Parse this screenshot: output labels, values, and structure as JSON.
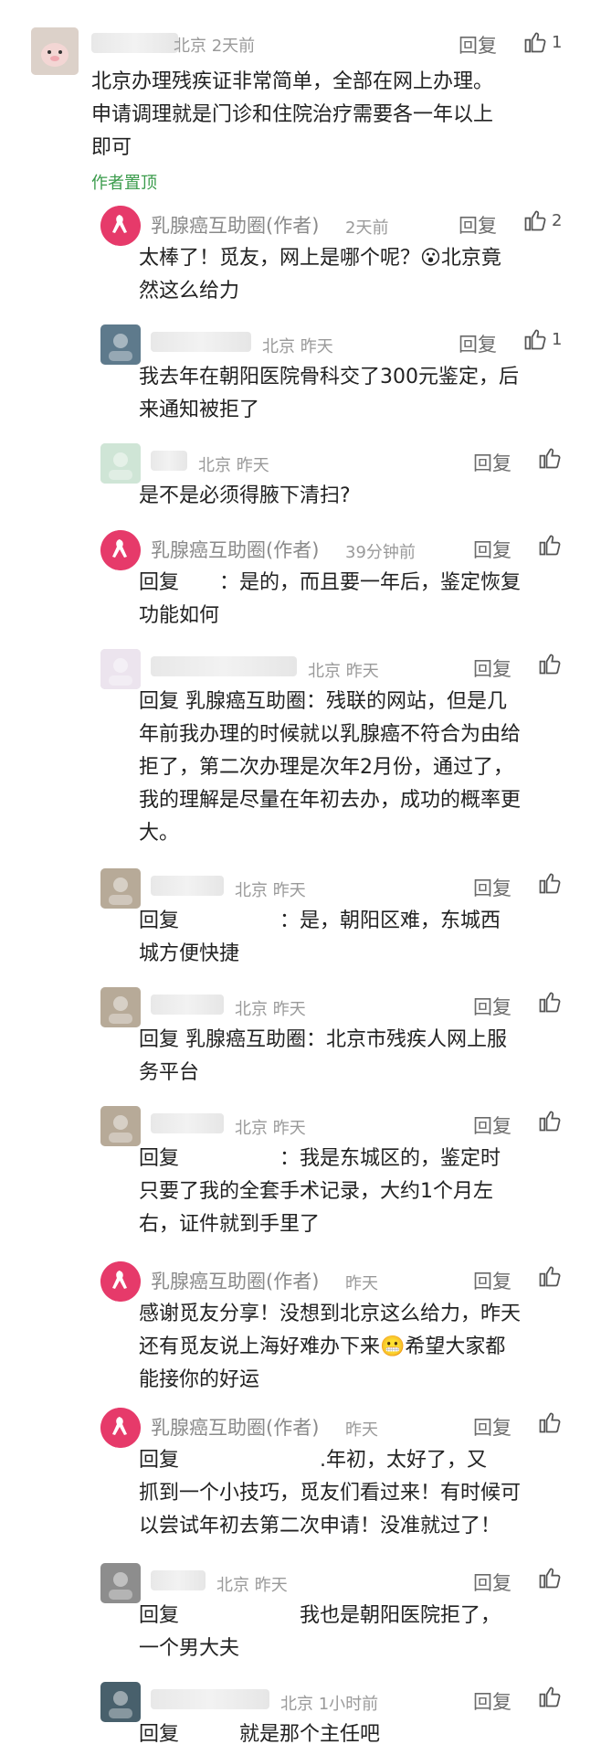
{
  "header": {
    "location": "北京",
    "time": "2天前",
    "reply": "回复",
    "likes": "1",
    "content_lines": [
      "北京办理残疾证非常简单，全部在网上办理。",
      "申请调理就是门诊和住院治疗需要各一年以上",
      "即可"
    ],
    "pinned": "作者置顶"
  },
  "replies": [
    {
      "name": "乳腺癌互助圈(作者)",
      "location": "",
      "time": "2天前",
      "likes": "2",
      "lines": [
        "太棒了！觅友，网上是哪个呢？😮北京竟",
        "然这么给力"
      ]
    },
    {
      "name": "",
      "location": "北京",
      "time": "昨天",
      "likes": "1",
      "lines": [
        "我去年在朝阳医院骨科交了300元鉴定，后",
        "来通知被拒了"
      ]
    },
    {
      "name": "",
      "location": "北京",
      "time": "昨天",
      "likes": "",
      "lines": [
        "是不是必须得腋下清扫?"
      ]
    },
    {
      "name": "乳腺癌互助圈(作者)",
      "location": "",
      "time": "39分钟前",
      "likes": "",
      "lines": [
        "回复　　：是的，而且要一年后，鉴定恢复",
        "功能如何"
      ]
    },
    {
      "name": "",
      "location": "北京",
      "time": "昨天",
      "likes": "",
      "lines": [
        "回复 乳腺癌互助圈：残联的网站，但是几",
        "年前我办理的时候就以乳腺癌不符合为由给",
        "拒了，第二次办理是次年2月份，通过了，",
        "我的理解是尽量在年初去办，成功的概率更",
        "大。"
      ]
    },
    {
      "name": "",
      "location": "北京",
      "time": "昨天",
      "likes": "",
      "lines": [
        "回复　　　　　：是，朝阳区难，东城西",
        "城方便快捷"
      ]
    },
    {
      "name": "",
      "location": "北京",
      "time": "昨天",
      "likes": "",
      "lines": [
        "回复 乳腺癌互助圈：北京市残疾人网上服",
        "务平台"
      ]
    },
    {
      "name": "",
      "location": "北京",
      "time": "昨天",
      "likes": "",
      "lines": [
        "回复　　　　　：我是东城区的，鉴定时",
        "只要了我的全套手术记录，大约1个月左",
        "右，证件就到手里了"
      ]
    },
    {
      "name": "乳腺癌互助圈(作者)",
      "location": "",
      "time": "昨天",
      "likes": "",
      "lines": [
        "感谢觅友分享！没想到北京这么给力，昨天",
        "还有觅友说上海好难办下来😬希望大家都",
        "能接你的好运"
      ]
    },
    {
      "name": "乳腺癌互助圈(作者)",
      "location": "",
      "time": "昨天",
      "likes": "",
      "lines": [
        "回复　　　　　　　.年初，太好了，又",
        "抓到一个小技巧，觅友们看过来！有时候可",
        "以尝试年初去第二次申请！没准就过了！"
      ]
    },
    {
      "name": "",
      "location": "北京",
      "time": "昨天",
      "likes": "",
      "lines": [
        "回复　　　　　　我也是朝阳医院拒了，",
        "一个男大夫"
      ]
    },
    {
      "name": "",
      "location": "北京",
      "time": "1小时前",
      "likes": "",
      "lines": [
        "回复　　　就是那个主任吧"
      ]
    }
  ],
  "reply_label": "回复",
  "colors": {
    "accent_pink": "#e63a6a",
    "pinned_green": "#3a9b4b",
    "meta_gray": "#9a9a9a"
  }
}
